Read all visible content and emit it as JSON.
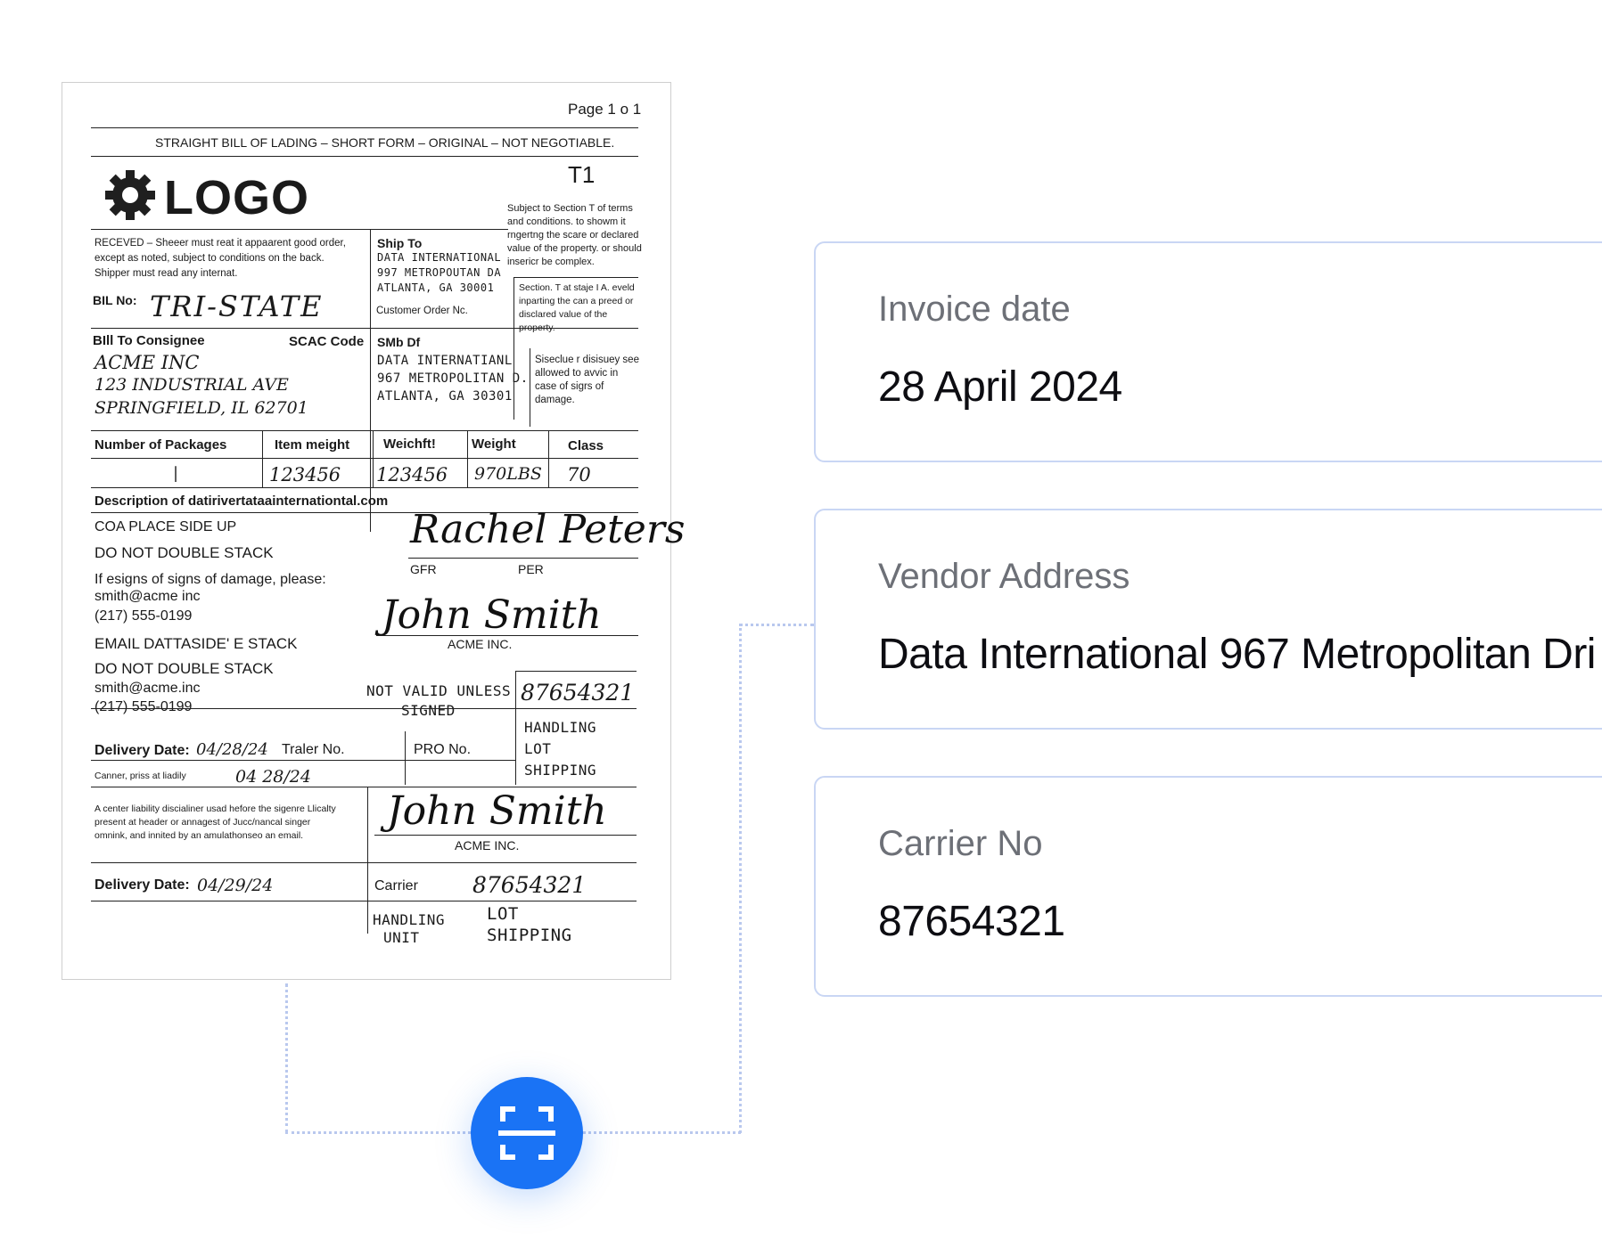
{
  "document": {
    "page_label": "Page 1 o 1",
    "header": "STRAIGHT BILL OF LADING – SHORT FORM – ORIGINAL – NOT NEGOTIABLE.",
    "logo_text": "LOGO",
    "logo_icon": "gear-icon",
    "t1": "T1",
    "terms_text": "Subject to Section T of terms and conditions. to showm it rngertng the scare or declared value of the property. or should insericr be complex.",
    "received_text": "RECEVED – Sheeer must reat it appaarent good order, except as noted, subject to conditions on the back. Shipper must read any internat.",
    "ship_to_label": "Ship To",
    "ship_to_lines": [
      "DATA INTERNATIONAL",
      "997 METROPOUTAN DA",
      "ATLANTA, GA 30001"
    ],
    "customer_order_label": "Customer Order Nc.",
    "section_text": "Section. T at staje I A. eveld inparting the can a preed or disclared value of the property.",
    "bil_no_label": "BIL No:",
    "bil_no_value": "TRI-STATE",
    "bill_to_label": "BIll To Consignee",
    "scac_label": "SCAC Code",
    "bill_to_lines": [
      "ACME INC",
      "123 INDUSTRIAL AVE",
      "SPRINGFIELD, IL 62701"
    ],
    "ship_df_label": "SMb Df",
    "ship_df_lines": [
      "DATA INTERNATIANL",
      "967 METROPOLITAN D.",
      "ATLANTA, GA 30301"
    ],
    "disclaimer_text": "Sisecluе r disisuey see allowed to avvic in case of sigrs of damage.",
    "table_headers": [
      "Number of Packages",
      "Item meight",
      "Weichft!",
      "Weight",
      "Class"
    ],
    "table_values": [
      "|",
      "123456",
      "123456",
      "970LBS",
      "70"
    ],
    "description_label": "Description of datirivertataainternationtal.com",
    "desc_lines_1": [
      "COA PLACE SIDE UP",
      "DO NOT DOUBLE STACK",
      "If esigns of signs of damage, please:",
      "smith@acme inc",
      "(217) 555-0199"
    ],
    "desc_lines_2": [
      "EMAIL DATTASIDE' E STACK",
      "DO NOT DOUBLE STACK",
      "smith@acme.inc",
      "(217) 555-0199"
    ],
    "sig_rachel": "Rachel Peters",
    "gfr_label": "GFR",
    "per_label": "PER",
    "sig_john": "John Smith",
    "acme_label": "ACME INC.",
    "not_valid_lines": [
      "NOT VALID UNLESS",
      "SIGNED"
    ],
    "number_box": "87654321",
    "handling_lines": [
      "HANDLING",
      "LOT",
      "SHIPPING"
    ],
    "delivery_label": "Delivery Date:",
    "delivery_value_1": "04/28/24",
    "trailer_label": "Traler No.",
    "pro_label": "PRO No.",
    "carrier_liab_label": "Canner, priss at liadily",
    "carrier_liab_value": "04 28/24",
    "liability_text": "A center liability discialiner usad hefore the sigenre Llicalty present at header or annagest of Jucc/nancal singer omnink, and innited by an amulathonseo an email.",
    "sig_john_2": "John Smith",
    "acme_label_2": "ACME INC.",
    "delivery_value_2": "04/29/24",
    "carrier_label": "Carrier",
    "carrier_value": "87654321",
    "handling_unit_lines": [
      "HANDLING",
      "UNIT"
    ],
    "lot_shipping_lines": [
      "LOT",
      "SHIPPING"
    ]
  },
  "fields": [
    {
      "label": "Invoice date",
      "value": "28 April 2024"
    },
    {
      "label": "Vendor Address",
      "value": "Data International 967 Metropolitan Dri"
    },
    {
      "label": "Carrier No",
      "value": "87654321"
    }
  ],
  "scan_button": {
    "icon": "scan-icon",
    "color": "#1a73f5"
  },
  "colors": {
    "card_border": "#c9d6f4",
    "connector": "#b9c8ee",
    "label": "#6d7077"
  }
}
